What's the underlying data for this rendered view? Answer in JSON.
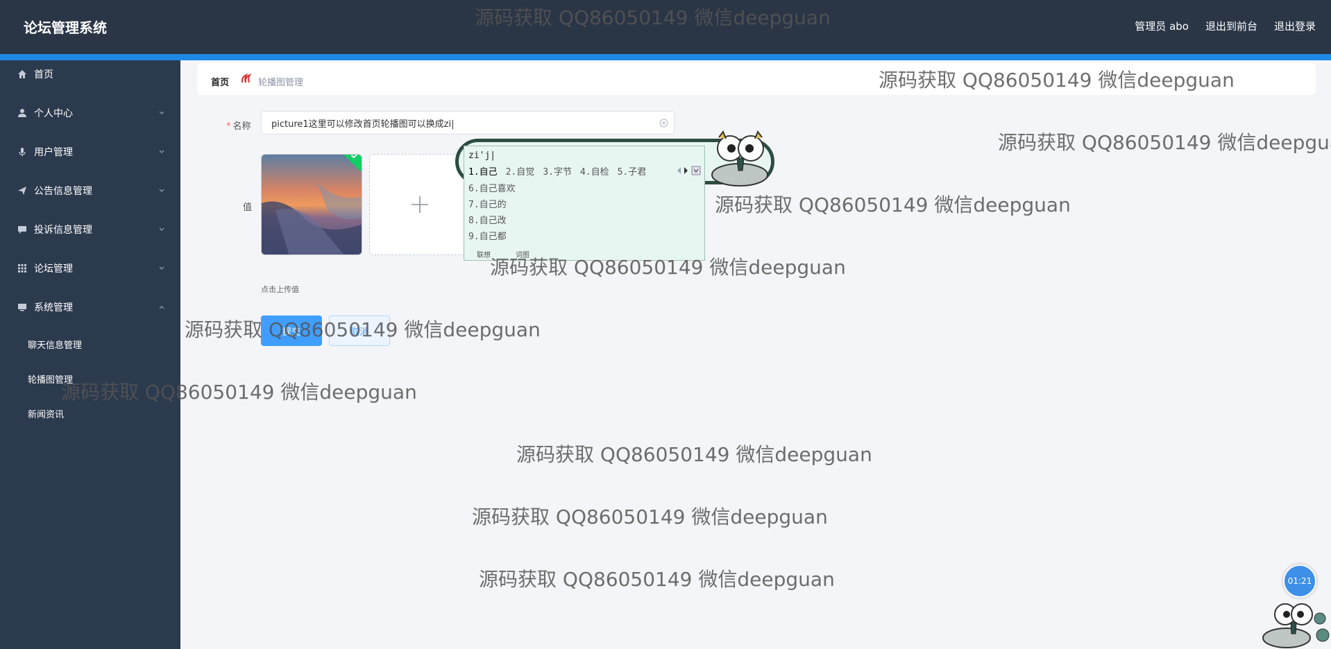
{
  "header": {
    "app_title": "论坛管理系统",
    "user_label": "管理员 abo",
    "to_frontend": "退出到前台",
    "logout": "退出登录"
  },
  "sidebar": {
    "items": [
      {
        "label": "首页",
        "icon": "home-icon"
      },
      {
        "label": "个人中心",
        "icon": "user-icon"
      },
      {
        "label": "用户管理",
        "icon": "microphone-icon"
      },
      {
        "label": "公告信息管理",
        "icon": "paper-plane-icon"
      },
      {
        "label": "投诉信息管理",
        "icon": "chat-icon"
      },
      {
        "label": "论坛管理",
        "icon": "grid-icon"
      },
      {
        "label": "系统管理",
        "icon": "monitor-icon"
      }
    ],
    "sub_items": [
      "聊天信息管理",
      "轮播图管理",
      "新闻资讯"
    ]
  },
  "breadcrumb": {
    "home": "首页",
    "current": "轮播图管理"
  },
  "form": {
    "name_label": "名称",
    "name_value": "picture1这里可以修改首页轮播图可以换成zi|",
    "value_label": "值",
    "upload_tip": "点击上传值",
    "submit": "提交",
    "cancel": "取消"
  },
  "ime": {
    "pinyin": "zi'j|",
    "row1": [
      "1.自己",
      "2.自觉",
      "3.字节",
      "4.自检",
      "5.子君"
    ],
    "list": [
      "6.自己喜欢",
      "7.自己的",
      "8.自己改",
      "9.自己都"
    ],
    "footer": [
      "联想",
      "词图"
    ]
  },
  "watermark_text": "源码获取 QQ86050149 微信deepguan",
  "timer": "01:21",
  "colors": {
    "header_bg": "#2a3546",
    "accent": "#1e88e5",
    "sidebar_bg": "#2c3a4e",
    "primary_button": "#409eff",
    "success_check": "#13ce66"
  }
}
